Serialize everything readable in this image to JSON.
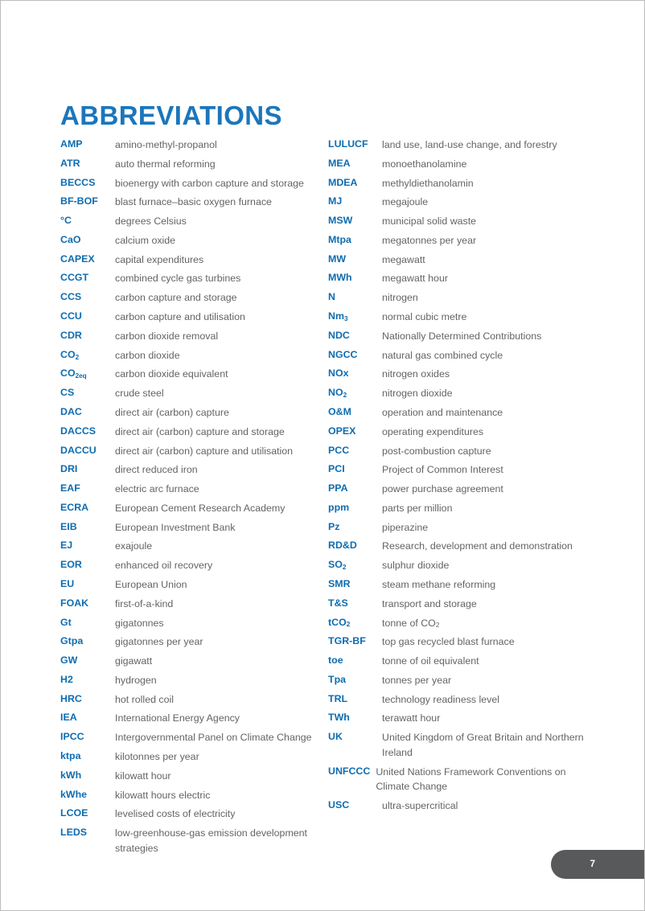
{
  "document": {
    "title": "ABBREVIATIONS",
    "page_number": "7",
    "accent_color": "#1b76bc",
    "term_color": "#0e6cb0",
    "definition_color": "#636466",
    "page_tab_color": "#58595b"
  },
  "columns": {
    "left": [
      {
        "term": "AMP",
        "definition": "amino-methyl-propanol"
      },
      {
        "term": "ATR",
        "definition": "auto thermal reforming"
      },
      {
        "term": "BECCS",
        "definition": "bioenergy with carbon capture and storage"
      },
      {
        "term": "BF-BOF",
        "definition": "blast furnace–basic oxygen furnace"
      },
      {
        "term": "°C",
        "definition": "degrees Celsius"
      },
      {
        "term": "CaO",
        "definition": "calcium oxide"
      },
      {
        "term": "CAPEX",
        "definition": "capital expenditures"
      },
      {
        "term": "CCGT",
        "definition": "combined cycle gas turbines"
      },
      {
        "term": "CCS",
        "definition": "carbon capture and storage"
      },
      {
        "term": "CCU",
        "definition": "carbon capture and utilisation"
      },
      {
        "term": "CDR",
        "definition": "carbon dioxide removal"
      },
      {
        "term": "CO2",
        "term_html": "CO<sub>2</sub>",
        "definition": "carbon dioxide"
      },
      {
        "term": "CO2eq",
        "term_html": "CO<sub>2eq</sub>",
        "definition": "carbon dioxide equivalent"
      },
      {
        "term": "CS",
        "definition": "crude steel"
      },
      {
        "term": "DAC",
        "definition": "direct air (carbon) capture"
      },
      {
        "term": "DACCS",
        "definition": "direct air (carbon) capture and storage"
      },
      {
        "term": "DACCU",
        "definition": "direct air (carbon) capture and utilisation"
      },
      {
        "term": "DRI",
        "definition": "direct reduced iron"
      },
      {
        "term": "EAF",
        "definition": "electric arc furnace"
      },
      {
        "term": "ECRA",
        "definition": "European Cement Research Academy"
      },
      {
        "term": "EIB",
        "definition": "European Investment Bank"
      },
      {
        "term": "EJ",
        "definition": "exajoule"
      },
      {
        "term": "EOR",
        "definition": "enhanced oil recovery"
      },
      {
        "term": "EU",
        "definition": "European Union"
      },
      {
        "term": "FOAK",
        "definition": "first-of-a-kind"
      },
      {
        "term": "Gt",
        "definition": "gigatonnes"
      },
      {
        "term": "Gtpa",
        "definition": "gigatonnes per year"
      },
      {
        "term": "GW",
        "definition": "gigawatt"
      },
      {
        "term": "H2",
        "definition": "hydrogen"
      },
      {
        "term": "HRC",
        "definition": "hot rolled coil"
      },
      {
        "term": "IEA",
        "definition": "International Energy Agency"
      },
      {
        "term": "IPCC",
        "definition": "Intergovernmental Panel on Climate Change"
      },
      {
        "term": "ktpa",
        "definition": "kilotonnes per year"
      },
      {
        "term": "kWh",
        "definition": "kilowatt hour"
      },
      {
        "term": "kWhe",
        "definition": "kilowatt hours electric"
      },
      {
        "term": "LCOE",
        "definition": "levelised costs of electricity"
      },
      {
        "term": "LEDS",
        "definition": "low-greenhouse-gas emission development strategies"
      }
    ],
    "right": [
      {
        "term": "LULUCF",
        "definition": "land use, land-use change, and forestry"
      },
      {
        "term": "MEA",
        "definition": "monoethanolamine"
      },
      {
        "term": "MDEA",
        "definition": "methyldiethanolamin"
      },
      {
        "term": "MJ",
        "definition": "megajoule"
      },
      {
        "term": "MSW",
        "definition": "municipal solid waste"
      },
      {
        "term": "Mtpa",
        "definition": "megatonnes per year"
      },
      {
        "term": "MW",
        "definition": "megawatt"
      },
      {
        "term": "MWh",
        "definition": "megawatt hour"
      },
      {
        "term": "N",
        "definition": "nitrogen"
      },
      {
        "term": "Nm3",
        "term_html": "Nm<sub>3</sub>",
        "definition": "normal cubic metre"
      },
      {
        "term": "NDC",
        "definition": "Nationally Determined Contributions"
      },
      {
        "term": "NGCC",
        "definition": "natural gas combined cycle"
      },
      {
        "term": "NOx",
        "definition": "nitrogen oxides"
      },
      {
        "term": "NO2",
        "term_html": "NO<sub>2</sub>",
        "definition": "nitrogen dioxide"
      },
      {
        "term": "O&M",
        "definition": "operation and maintenance"
      },
      {
        "term": "OPEX",
        "definition": "operating expenditures"
      },
      {
        "term": "PCC",
        "definition": "post-combustion capture"
      },
      {
        "term": "PCI",
        "definition": "Project of Common Interest"
      },
      {
        "term": "PPA",
        "definition": "power purchase agreement"
      },
      {
        "term": "ppm",
        "definition": "parts per million"
      },
      {
        "term": "Pz",
        "definition": "piperazine"
      },
      {
        "term": "RD&D",
        "definition": "Research, development and demonstration"
      },
      {
        "term": "SO2",
        "term_html": "SO<sub>2</sub>",
        "definition": "sulphur dioxide"
      },
      {
        "term": "SMR",
        "definition": "steam methane reforming"
      },
      {
        "term": "T&S",
        "definition": "transport and storage"
      },
      {
        "term": "tCO2",
        "term_html": "tCO<sub>2</sub>",
        "definition": "tonne of CO2",
        "definition_html": "tonne of CO<sub>2</sub>"
      },
      {
        "term": "TGR-BF",
        "definition": "top gas recycled blast furnace"
      },
      {
        "term": "toe",
        "definition": "tonne of oil equivalent"
      },
      {
        "term": "Tpa",
        "definition": "tonnes per year"
      },
      {
        "term": "TRL",
        "definition": "technology readiness level"
      },
      {
        "term": "TWh",
        "definition": "terawatt hour"
      },
      {
        "term": "UK",
        "definition": "United Kingdom of Great Britain and Northern Ireland"
      },
      {
        "term": "UNFCCC",
        "definition": "United Nations Framework Conventions on Climate Change",
        "wide": true
      },
      {
        "term": "USC",
        "definition": "ultra-supercritical"
      }
    ]
  }
}
